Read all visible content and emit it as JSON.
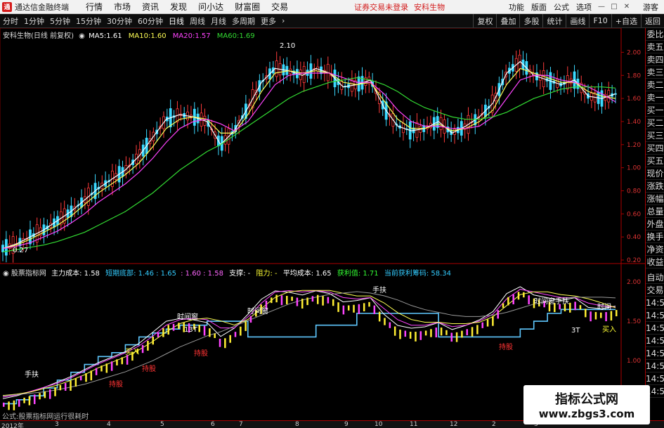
{
  "menubar": {
    "app_title": "通达信金融终端",
    "items": [
      "行情",
      "市场",
      "资讯",
      "发现",
      "问小达",
      "财富圈",
      "交易"
    ],
    "notice": "证券交易未登录",
    "notice_stock": "安科生物",
    "right_items": [
      "功能",
      "版面",
      "公式",
      "选项"
    ],
    "guest": "游客"
  },
  "toolbar": {
    "periods": [
      "分时",
      "1分钟",
      "5分钟",
      "15分钟",
      "30分钟",
      "60分钟",
      "日线",
      "周线",
      "月线",
      "多周期",
      "更多"
    ],
    "active_period": "日线",
    "right_buttons": [
      "复权",
      "叠加",
      "多股",
      "统计",
      "画线",
      "F10",
      "+自选",
      "返回"
    ]
  },
  "main_chart": {
    "header_title": "安科生物(日线 前复权)",
    "ma": [
      {
        "label": "MA5:",
        "value": "1.61",
        "color": "#ffffff"
      },
      {
        "label": "MA10:",
        "value": "1.60",
        "color": "#ffff55"
      },
      {
        "label": "MA20:",
        "value": "1.57",
        "color": "#ff44ff"
      },
      {
        "label": "MA60:",
        "value": "1.69",
        "color": "#33dd33"
      }
    ],
    "high_label": "2.10",
    "low_label": "0.27",
    "y_ticks": [
      "2.00",
      "1.80",
      "1.60",
      "1.40",
      "1.20",
      "1.00",
      "0.80",
      "0.60",
      "0.40",
      "0.20"
    ]
  },
  "sub_chart": {
    "header_title": "股票指标网",
    "items": [
      {
        "text": "主力成本: 1.58",
        "color": "#ffffff"
      },
      {
        "text": "短期底部: 1.46 : 1.65",
        "color": "#33ccff"
      },
      {
        "text": ": 1.60 : 1.58",
        "color": "#ff66ff"
      },
      {
        "text": "支撑: -",
        "color": "#ffffff"
      },
      {
        "text": "阻力: -",
        "color": "#ffff33"
      },
      {
        "text": "平均成本: 1.65",
        "color": "#ffffff"
      },
      {
        "text": "获利值: 1.71",
        "color": "#33ff33"
      },
      {
        "text": "当前获利筹码: 58.34",
        "color": "#33ccff"
      }
    ],
    "y_ticks": [
      "2.00",
      "1.50",
      "1.00",
      "0.50"
    ],
    "annotations": [
      {
        "text": "手扶",
        "color": "#ffffff"
      },
      {
        "text": "时间窗",
        "color": "#ffffff"
      },
      {
        "text": "13T",
        "color": "#ffffff"
      },
      {
        "text": "时间窗",
        "color": "#ffffff"
      },
      {
        "text": "时间窗手扶",
        "color": "#ffffff"
      },
      {
        "text": "时间",
        "color": "#ffffff"
      },
      {
        "text": "持股",
        "color": "#ff3333"
      },
      {
        "text": "持股",
        "color": "#ff3333"
      },
      {
        "text": "持股",
        "color": "#ff3333"
      },
      {
        "text": "持股",
        "color": "#ff3333"
      },
      {
        "text": "手扶",
        "color": "#ffffff"
      },
      {
        "text": "3T",
        "color": "#ffffff"
      },
      {
        "text": "买入",
        "color": "#ffff33"
      },
      {
        "text": "买入",
        "color": "#ffff33"
      }
    ]
  },
  "footer_note": "公式:股票指标网运行很耗时",
  "x_axis": [
    "2012年",
    "3",
    "4",
    "5",
    "6",
    "7",
    "8",
    "9",
    "10",
    "11",
    "12",
    "2",
    "3"
  ],
  "sidebar": {
    "items": [
      "委比",
      "卖五",
      "卖四",
      "卖三",
      "卖二",
      "卖一",
      "买一",
      "买二",
      "买三",
      "买四",
      "买五",
      "现价",
      "涨跌",
      "涨幅",
      "总量",
      "外盘",
      "换手",
      "净资",
      "收益"
    ],
    "sub_items": [
      "自动",
      "交易",
      "14:5",
      "14:5",
      "14:5",
      "14:5",
      "14:5",
      "14:5",
      "14:5",
      "14:5"
    ]
  },
  "watermark": {
    "title": "指标公式网",
    "url": "www.zbgs3.com"
  },
  "chart_data": {
    "type": "line",
    "title": "安科生物(日线 前复权)",
    "ylim": [
      0.2,
      2.1
    ],
    "series": [
      {
        "name": "MA5",
        "color": "#ffffff",
        "values": [
          0.3,
          0.34,
          0.4,
          0.46,
          0.54,
          0.62,
          0.72,
          0.82,
          0.9,
          0.98,
          1.1,
          1.26,
          1.42,
          1.46,
          1.44,
          1.4,
          1.2,
          1.32,
          1.52,
          1.74,
          1.86,
          1.84,
          1.8,
          1.86,
          1.82,
          1.7,
          1.72,
          1.76,
          1.52,
          1.36,
          1.32,
          1.34,
          1.4,
          1.3,
          1.36,
          1.44,
          1.56,
          1.82,
          1.92,
          1.8,
          1.76,
          1.72,
          1.76,
          1.62,
          1.6,
          1.64
        ]
      },
      {
        "name": "MA10",
        "color": "#ffff55",
        "values": [
          0.3,
          0.33,
          0.38,
          0.44,
          0.5,
          0.58,
          0.68,
          0.78,
          0.86,
          0.94,
          1.04,
          1.18,
          1.34,
          1.42,
          1.44,
          1.42,
          1.3,
          1.3,
          1.46,
          1.66,
          1.82,
          1.84,
          1.82,
          1.84,
          1.82,
          1.74,
          1.72,
          1.74,
          1.58,
          1.42,
          1.34,
          1.34,
          1.38,
          1.32,
          1.34,
          1.4,
          1.5,
          1.72,
          1.86,
          1.82,
          1.78,
          1.74,
          1.74,
          1.66,
          1.62,
          1.6
        ]
      },
      {
        "name": "MA20",
        "color": "#ff44ff",
        "values": [
          0.3,
          0.32,
          0.35,
          0.4,
          0.45,
          0.52,
          0.6,
          0.7,
          0.78,
          0.86,
          0.96,
          1.08,
          1.22,
          1.34,
          1.4,
          1.42,
          1.38,
          1.32,
          1.4,
          1.56,
          1.72,
          1.8,
          1.82,
          1.82,
          1.82,
          1.78,
          1.74,
          1.74,
          1.64,
          1.5,
          1.4,
          1.36,
          1.36,
          1.34,
          1.34,
          1.36,
          1.44,
          1.6,
          1.76,
          1.8,
          1.8,
          1.76,
          1.74,
          1.7,
          1.64,
          1.57
        ]
      },
      {
        "name": "MA60",
        "color": "#33dd33",
        "values": [
          0.27,
          0.29,
          0.31,
          0.33,
          0.36,
          0.4,
          0.44,
          0.5,
          0.56,
          0.62,
          0.7,
          0.78,
          0.88,
          0.98,
          1.06,
          1.14,
          1.2,
          1.28,
          1.36,
          1.44,
          1.52,
          1.6,
          1.66,
          1.7,
          1.74,
          1.76,
          1.78,
          1.76,
          1.72,
          1.66,
          1.58,
          1.52,
          1.48,
          1.44,
          1.42,
          1.42,
          1.44,
          1.48,
          1.54,
          1.6,
          1.64,
          1.68,
          1.7,
          1.7,
          1.7,
          1.69
        ]
      }
    ]
  }
}
